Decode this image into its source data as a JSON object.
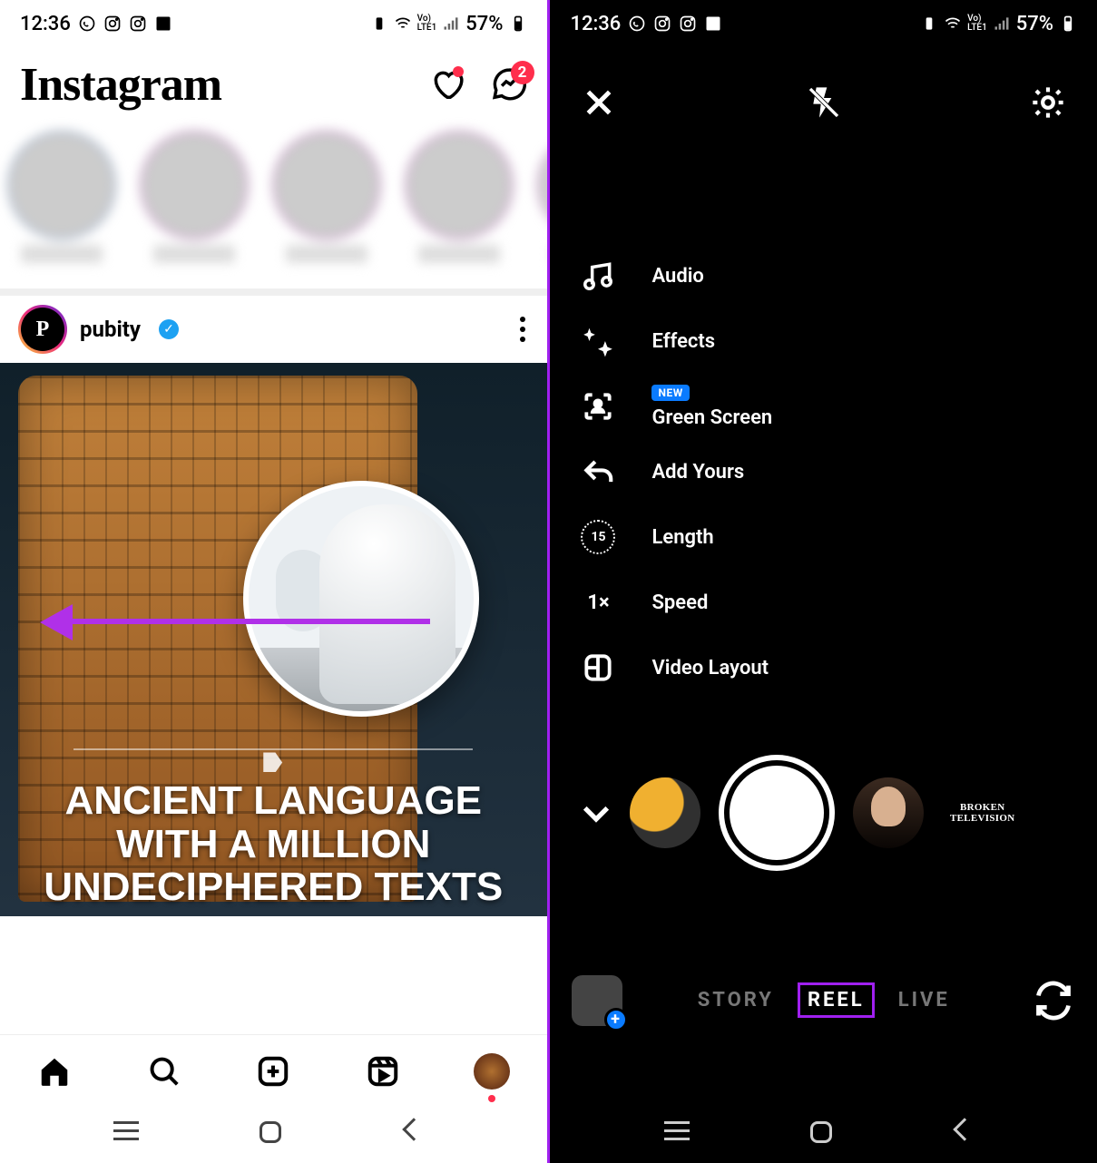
{
  "status": {
    "time": "12:36",
    "battery_text": "57%"
  },
  "logo": "Instagram",
  "header": {
    "messenger_badge": "2"
  },
  "post": {
    "username": "pubity",
    "caption_overlay": "ANCIENT LANGUAGE WITH A MILLION UNDECIPHERED TEXTS"
  },
  "camera_tools": {
    "audio": "Audio",
    "effects": "Effects",
    "green_screen": "Green Screen",
    "green_screen_badge": "NEW",
    "add_yours": "Add Yours",
    "length": "Length",
    "length_value": "15",
    "speed": "Speed",
    "speed_value": "1×",
    "video_layout": "Video Layout"
  },
  "filters": {
    "broken_tv": "BROKEN TELEVISION"
  },
  "modes": {
    "story": "STORY",
    "reel": "REEL",
    "live": "LIVE"
  }
}
